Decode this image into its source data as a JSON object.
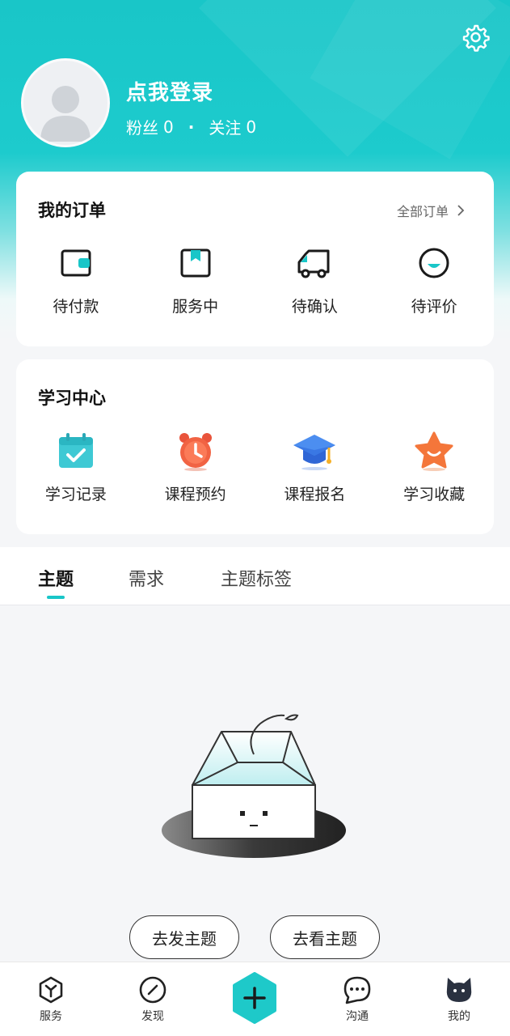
{
  "header": {
    "login_text": "点我登录",
    "fans_label": "粉丝",
    "fans_count": "0",
    "follow_label": "关注",
    "follow_count": "0",
    "dot": "·"
  },
  "orders": {
    "title": "我的订单",
    "all_orders": "全部订单",
    "items": [
      {
        "label": "待付款",
        "icon": "wallet-icon"
      },
      {
        "label": "服务中",
        "icon": "bookmark-box-icon"
      },
      {
        "label": "待确认",
        "icon": "truck-icon"
      },
      {
        "label": "待评价",
        "icon": "smile-icon"
      }
    ]
  },
  "learning": {
    "title": "学习中心",
    "items": [
      {
        "label": "学习记录",
        "icon": "calendar-check-icon"
      },
      {
        "label": "课程预约",
        "icon": "alarm-clock-icon"
      },
      {
        "label": "课程报名",
        "icon": "graduation-cap-icon"
      },
      {
        "label": "学习收藏",
        "icon": "star-icon"
      }
    ]
  },
  "tabs": [
    {
      "label": "主题",
      "active": true
    },
    {
      "label": "需求",
      "active": false
    },
    {
      "label": "主题标签",
      "active": false
    }
  ],
  "empty_actions": {
    "post_topic": "去发主题",
    "view_topic": "去看主题"
  },
  "bottom_nav": [
    {
      "label": "服务",
      "icon": "cube-icon"
    },
    {
      "label": "发现",
      "icon": "compass-icon"
    },
    {
      "label": "",
      "icon": "plus-hexagon-icon"
    },
    {
      "label": "沟通",
      "icon": "chat-bubble-icon"
    },
    {
      "label": "我的",
      "icon": "cat-avatar-icon"
    }
  ],
  "colors": {
    "accent": "#19c6c8",
    "text_dark": "#222222"
  }
}
